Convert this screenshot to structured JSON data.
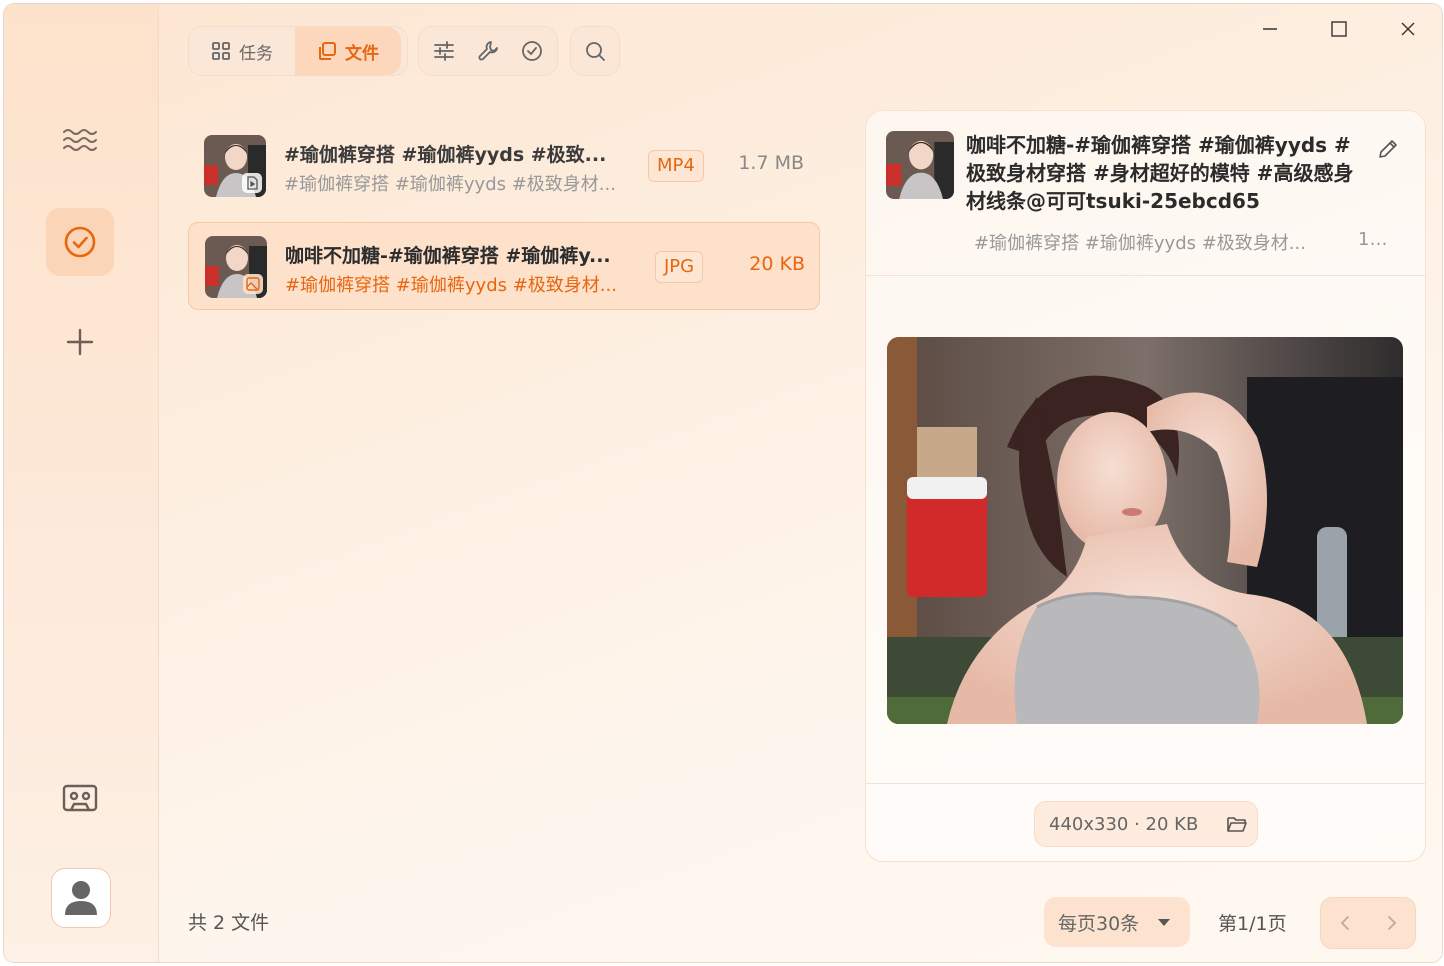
{
  "toolbar": {
    "tasks_label": "任务",
    "files_label": "文件"
  },
  "files": [
    {
      "title": "#瑜伽裤穿搭 #瑜伽裤yyds #极致...",
      "subtitle": "#瑜伽裤穿搭 #瑜伽裤yyds #极致身材...",
      "type": "MP4",
      "size": "1.7 MB"
    },
    {
      "title": "咖啡不加糖-#瑜伽裤穿搭 #瑜伽裤y...",
      "subtitle": "#瑜伽裤穿搭 #瑜伽裤yyds #极致身材...",
      "type": "JPG",
      "size": "20 KB"
    }
  ],
  "detail": {
    "title": "咖啡不加糖-#瑜伽裤穿搭 #瑜伽裤yyds # 极致身材穿搭 #身材超好的模特 #高级感身材线条@可可tsuki-25ebcd65",
    "tags": "#瑜伽裤穿搭 #瑜伽裤yyds #极致身材...",
    "tags_extra": "1...",
    "meta": "440x330 · 20 KB"
  },
  "footer": {
    "count": "共 2 文件",
    "per_page": "每页30条",
    "page_info": "第1/1页"
  },
  "colors": {
    "accent": "#e8660f",
    "selected_bg": "#fde1cb"
  }
}
